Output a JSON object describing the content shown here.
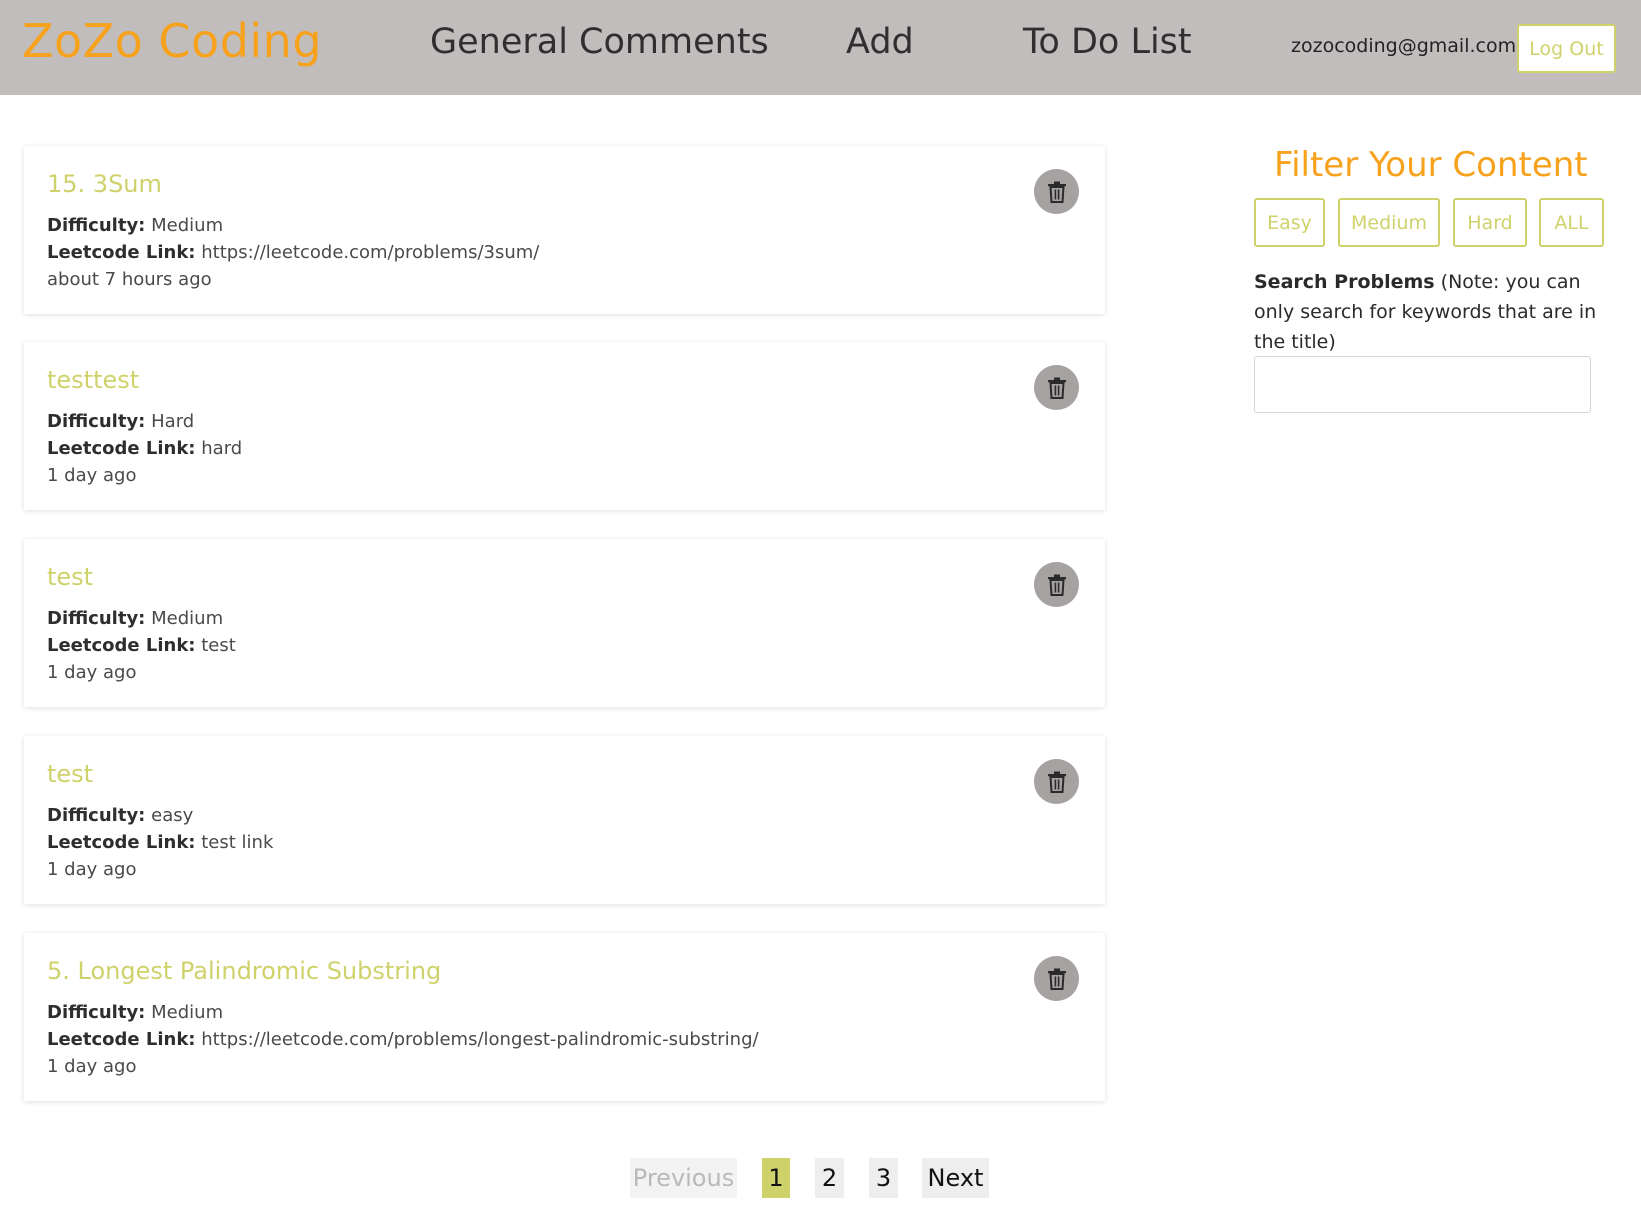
{
  "header": {
    "brand": "ZoZo Coding",
    "nav": {
      "general_comments": "General Comments",
      "add": "Add",
      "todo_list": "To Do List"
    },
    "user_email": "zozocoding@gmail.com",
    "logout_label": "Log Out"
  },
  "problems": [
    {
      "title": "15. 3Sum",
      "difficulty_label": "Difficulty:",
      "difficulty": "Medium",
      "link_label": "Leetcode Link:",
      "link": "https://leetcode.com/problems/3sum/",
      "time": "about 7 hours ago"
    },
    {
      "title": "testtest",
      "difficulty_label": "Difficulty:",
      "difficulty": "Hard",
      "link_label": "Leetcode Link:",
      "link": "hard",
      "time": "1 day ago"
    },
    {
      "title": "test",
      "difficulty_label": "Difficulty:",
      "difficulty": "Medium",
      "link_label": "Leetcode Link:",
      "link": "test",
      "time": "1 day ago"
    },
    {
      "title": "test",
      "difficulty_label": "Difficulty:",
      "difficulty": "easy",
      "link_label": "Leetcode Link:",
      "link": "test link",
      "time": "1 day ago"
    },
    {
      "title": "5. Longest Palindromic Substring",
      "difficulty_label": "Difficulty:",
      "difficulty": "Medium",
      "link_label": "Leetcode Link:",
      "link": "https://leetcode.com/problems/longest-palindromic-substring/",
      "time": "1 day ago"
    }
  ],
  "sidebar": {
    "heading": "Filter Your Content",
    "filters": [
      "Easy",
      "Medium",
      "Hard",
      "ALL"
    ],
    "search_label_bold": "Search Problems",
    "search_note": "(Note: you can only search for keywords that are in the title)",
    "search_value": ""
  },
  "pagination": {
    "previous": "Previous",
    "pages": [
      "1",
      "2",
      "3"
    ],
    "current": "1",
    "next": "Next"
  },
  "colors": {
    "brand_orange": "#f7a21d",
    "accent_yellow": "#cfd26b",
    "header_bg": "#c2bdbd",
    "delete_button_bg": "#a7a2a2"
  },
  "icons": {
    "delete": "trash-icon"
  }
}
